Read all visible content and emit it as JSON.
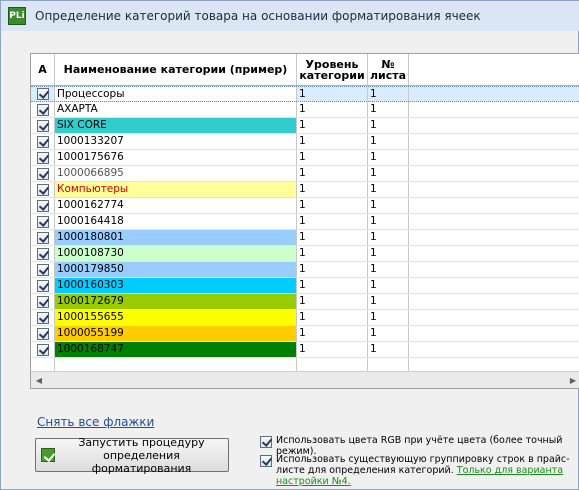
{
  "window": {
    "title": "Определение категорий товара на основании форматирования ячеек",
    "icon_text": "PLi"
  },
  "grid": {
    "headers": {
      "col_a": "А",
      "col_name": "Наименование категории (пример)",
      "col_level": "Уровень категории",
      "col_sheet": "№ листа"
    },
    "rows": [
      {
        "name": "Процессоры",
        "level": "1",
        "sheet": "1",
        "bg": "#ffffff",
        "fg": "#000000",
        "selected": true
      },
      {
        "name": "AXAPTA",
        "level": "1",
        "sheet": "1",
        "bg": "#ffffff",
        "fg": "#000000"
      },
      {
        "name": "SIX CORE",
        "level": "1",
        "sheet": "1",
        "bg": "#33cccc",
        "fg": "#000000"
      },
      {
        "name": "1000133207",
        "level": "1",
        "sheet": "1",
        "bg": "#ffffff",
        "fg": "#000000"
      },
      {
        "name": "1000175676",
        "level": "1",
        "sheet": "1",
        "bg": "#ffffff",
        "fg": "#000000"
      },
      {
        "name": "1000066895",
        "level": "1",
        "sheet": "1",
        "bg": "#ffffff",
        "fg": "#555555"
      },
      {
        "name": "Компьютеры",
        "level": "1",
        "sheet": "1",
        "bg": "#ffff99",
        "fg": "#d00000"
      },
      {
        "name": "1000162774",
        "level": "1",
        "sheet": "1",
        "bg": "#ffffff",
        "fg": "#000000"
      },
      {
        "name": "1000164418",
        "level": "1",
        "sheet": "1",
        "bg": "#ffffff",
        "fg": "#000000"
      },
      {
        "name": "1000180801",
        "level": "1",
        "sheet": "1",
        "bg": "#99ccff",
        "fg": "#000000"
      },
      {
        "name": "1000108730",
        "level": "1",
        "sheet": "1",
        "bg": "#ccffcc",
        "fg": "#000000"
      },
      {
        "name": "1000179850",
        "level": "1",
        "sheet": "1",
        "bg": "#99ccff",
        "fg": "#000000"
      },
      {
        "name": "1000160303",
        "level": "1",
        "sheet": "1",
        "bg": "#00ccff",
        "fg": "#000000"
      },
      {
        "name": "1000172679",
        "level": "1",
        "sheet": "1",
        "bg": "#99cc00",
        "fg": "#000000"
      },
      {
        "name": "1000155655",
        "level": "1",
        "sheet": "1",
        "bg": "#ffff00",
        "fg": "#000000"
      },
      {
        "name": "1000055199",
        "level": "1",
        "sheet": "1",
        "bg": "#ffcc00",
        "fg": "#000000"
      },
      {
        "name": "1000168747",
        "level": "1",
        "sheet": "1",
        "bg": "#008000",
        "fg": "#000000"
      }
    ]
  },
  "clear_flags_link": "Снять все флажки",
  "run_button": {
    "line1": "Запустить процедуру",
    "line2": "определения форматирования",
    "icon": "run-check-icon"
  },
  "options": {
    "rgb": {
      "label": "Использовать цвета RGB при учёте цвета (более точный режим).",
      "checked": true
    },
    "grouping": {
      "label": "Использовать существующую группировку строк в прайс-листе для определения категорий.",
      "link": "Только для варианта настройки №4.",
      "checked": true
    }
  }
}
